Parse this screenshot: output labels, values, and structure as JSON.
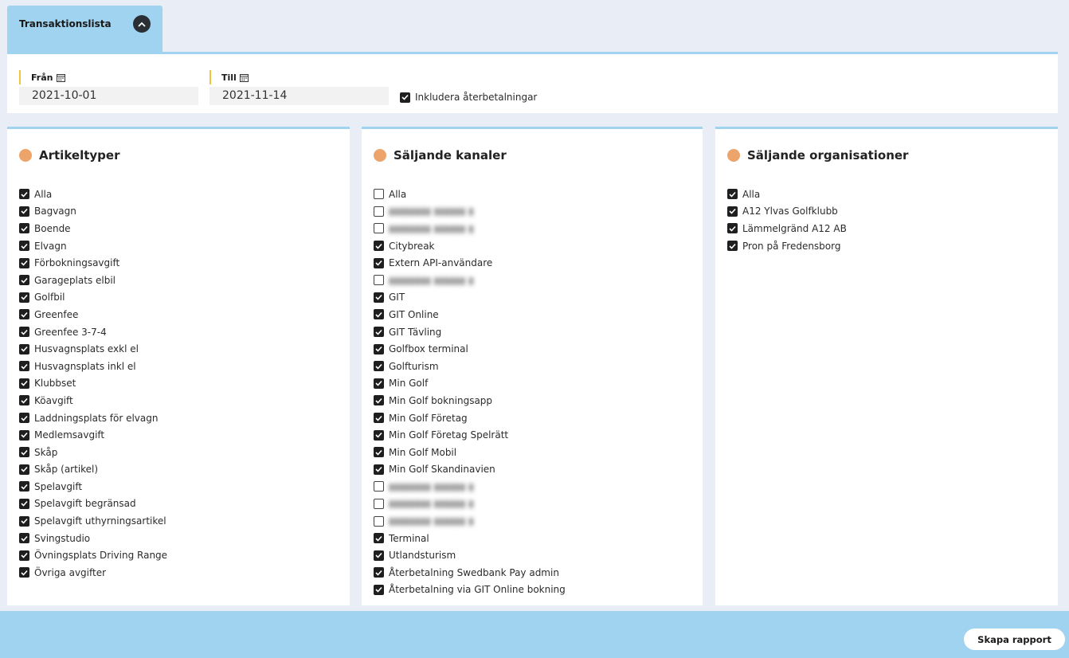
{
  "tab": {
    "title": "Transaktionslista"
  },
  "filters": {
    "from_label": "Från",
    "from_value": "2021-10-01",
    "to_label": "Till",
    "to_value": "2021-11-14",
    "include_refunds_label": "Inkludera återbetalningar",
    "include_refunds_checked": true
  },
  "panels": [
    {
      "title": "Artikeltyper",
      "items": [
        {
          "label": "Alla",
          "checked": true
        },
        {
          "label": "Bagvagn",
          "checked": true
        },
        {
          "label": "Boende",
          "checked": true
        },
        {
          "label": "Elvagn",
          "checked": true
        },
        {
          "label": "Förbokningsavgift",
          "checked": true
        },
        {
          "label": "Garageplats elbil",
          "checked": true
        },
        {
          "label": "Golfbil",
          "checked": true
        },
        {
          "label": "Greenfee",
          "checked": true
        },
        {
          "label": "Greenfee 3-7-4",
          "checked": true
        },
        {
          "label": "Husvagnsplats exkl el",
          "checked": true
        },
        {
          "label": "Husvagnsplats inkl el",
          "checked": true
        },
        {
          "label": "Klubbset",
          "checked": true
        },
        {
          "label": "Köavgift",
          "checked": true
        },
        {
          "label": "Laddningsplats för elvagn",
          "checked": true
        },
        {
          "label": "Medlemsavgift",
          "checked": true
        },
        {
          "label": "Skåp",
          "checked": true
        },
        {
          "label": "Skåp (artikel)",
          "checked": true
        },
        {
          "label": "Spelavgift",
          "checked": true
        },
        {
          "label": "Spelavgift begränsad",
          "checked": true
        },
        {
          "label": "Spelavgift uthyrningsartikel",
          "checked": true
        },
        {
          "label": "Svingstudio",
          "checked": true
        },
        {
          "label": "Övningsplats Driving Range",
          "checked": true
        },
        {
          "label": "Övriga avgifter",
          "checked": true
        }
      ]
    },
    {
      "title": "Säljande kanaler",
      "items": [
        {
          "label": "Alla",
          "checked": false
        },
        {
          "label": "",
          "checked": false,
          "blurred": true
        },
        {
          "label": "",
          "checked": false,
          "blurred": true
        },
        {
          "label": "Citybreak",
          "checked": true
        },
        {
          "label": "Extern API-användare",
          "checked": true
        },
        {
          "label": "",
          "checked": false,
          "blurred": true
        },
        {
          "label": "GIT",
          "checked": true
        },
        {
          "label": "GIT Online",
          "checked": true
        },
        {
          "label": "GIT Tävling",
          "checked": true
        },
        {
          "label": "Golfbox terminal",
          "checked": true
        },
        {
          "label": "Golfturism",
          "checked": true
        },
        {
          "label": "Min Golf",
          "checked": true
        },
        {
          "label": "Min Golf bokningsapp",
          "checked": true
        },
        {
          "label": "Min Golf Företag",
          "checked": true
        },
        {
          "label": "Min Golf Företag Spelrätt",
          "checked": true
        },
        {
          "label": "Min Golf Mobil",
          "checked": true
        },
        {
          "label": "Min Golf Skandinavien",
          "checked": true
        },
        {
          "label": "",
          "checked": false,
          "blurred": true
        },
        {
          "label": "",
          "checked": false,
          "blurred": true
        },
        {
          "label": "",
          "checked": false,
          "blurred": true
        },
        {
          "label": "Terminal",
          "checked": true
        },
        {
          "label": "Utlandsturism",
          "checked": true
        },
        {
          "label": "Återbetalning Swedbank Pay admin",
          "checked": true
        },
        {
          "label": "Återbetalning via GIT Online bokning",
          "checked": true
        }
      ]
    },
    {
      "title": "Säljande organisationer",
      "items": [
        {
          "label": "Alla",
          "checked": true
        },
        {
          "label": "A12 Ylvas Golfklubb",
          "checked": true
        },
        {
          "label": "Lämmelgränd A12 AB",
          "checked": true
        },
        {
          "label": "Pron på Fredensborg",
          "checked": true
        }
      ]
    }
  ],
  "actions": {
    "create_report": "Skapa rapport"
  }
}
